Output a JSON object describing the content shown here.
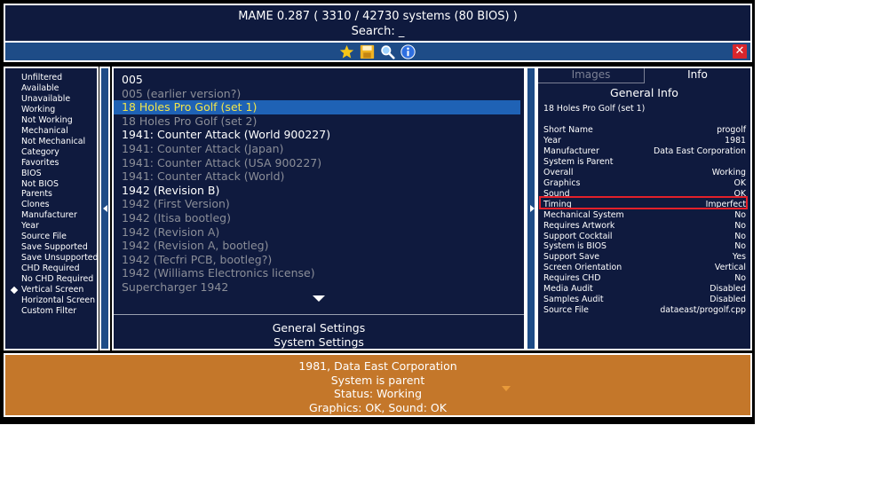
{
  "header": {
    "title": "MAME 0.287 ( 3310 / 42730 systems (80 BIOS) )",
    "search": "Search: _"
  },
  "toolbar": {
    "icons": [
      "star-icon",
      "save-icon",
      "search-icon",
      "info-icon"
    ],
    "close_label": "✕"
  },
  "filters": [
    "Unfiltered",
    "Available",
    "Unavailable",
    "Working",
    "Not Working",
    "Mechanical",
    "Not Mechanical",
    "Category",
    "Favorites",
    "BIOS",
    "Not BIOS",
    "Parents",
    "Clones",
    "Manufacturer",
    "Year",
    "Source File",
    "Save Supported",
    "Save Unsupported",
    "CHD Required",
    "No CHD Required",
    "Vertical Screen",
    "Horizontal Screen",
    "Custom Filter"
  ],
  "active_filter": "Vertical Screen",
  "games": [
    {
      "name": "005",
      "clone": false
    },
    {
      "name": "005 (earlier version?)",
      "clone": true
    },
    {
      "name": "18 Holes Pro Golf (set 1)",
      "clone": false,
      "selected": true
    },
    {
      "name": "18 Holes Pro Golf (set 2)",
      "clone": true
    },
    {
      "name": "1941: Counter Attack (World 900227)",
      "clone": false
    },
    {
      "name": "1941: Counter Attack (Japan)",
      "clone": true
    },
    {
      "name": "1941: Counter Attack (USA 900227)",
      "clone": true
    },
    {
      "name": "1941: Counter Attack (World)",
      "clone": true
    },
    {
      "name": "1942 (Revision B)",
      "clone": false
    },
    {
      "name": "1942 (First Version)",
      "clone": true
    },
    {
      "name": "1942 (Itisa bootleg)",
      "clone": true
    },
    {
      "name": "1942 (Revision A)",
      "clone": true
    },
    {
      "name": "1942 (Revision A, bootleg)",
      "clone": true
    },
    {
      "name": "1942 (Tecfri PCB, bootleg?)",
      "clone": true
    },
    {
      "name": "1942 (Williams Electronics license)",
      "clone": true
    },
    {
      "name": "Supercharger 1942",
      "clone": true
    }
  ],
  "settings": {
    "general": "General Settings",
    "system": "System Settings"
  },
  "info_panel": {
    "tab_images": "Images",
    "tab_info": "Info",
    "heading": "General Info",
    "subtitle": "18 Holes Pro Golf (set 1)",
    "rows": [
      {
        "label": "Short Name",
        "value": "progolf"
      },
      {
        "label": "Year",
        "value": "1981"
      },
      {
        "label": "Manufacturer",
        "value": "Data East Corporation"
      },
      {
        "label": "System is Parent",
        "value": ""
      },
      {
        "label": "Overall",
        "value": "Working"
      },
      {
        "label": "Graphics",
        "value": "OK"
      },
      {
        "label": "Sound",
        "value": "OK"
      },
      {
        "label": "Timing",
        "value": "Imperfect"
      },
      {
        "label": "Mechanical System",
        "value": "No"
      },
      {
        "label": "Requires Artwork",
        "value": "No"
      },
      {
        "label": "Support Cocktail",
        "value": "No"
      },
      {
        "label": "System is BIOS",
        "value": "No"
      },
      {
        "label": "Support Save",
        "value": "Yes"
      },
      {
        "label": "Screen Orientation",
        "value": "Vertical"
      },
      {
        "label": "Requires CHD",
        "value": "No"
      },
      {
        "label": "Media Audit",
        "value": "Disabled"
      },
      {
        "label": "Samples Audit",
        "value": "Disabled"
      },
      {
        "label": "Source File",
        "value": "dataeast/progolf.cpp"
      }
    ]
  },
  "status": {
    "lines": [
      "1981, Data East Corporation",
      "System is parent",
      "Status: Working",
      "Graphics: OK, Sound: OK"
    ]
  },
  "colors": {
    "panel_bg": "#0f1a3e",
    "toolbar_bg": "#1e4c87",
    "selected_bg": "#1f62b5",
    "selected_text": "#f2e54a",
    "clone_text": "#8b8e98",
    "status_bg": "#c4772a",
    "highlight": "#e3202a"
  }
}
